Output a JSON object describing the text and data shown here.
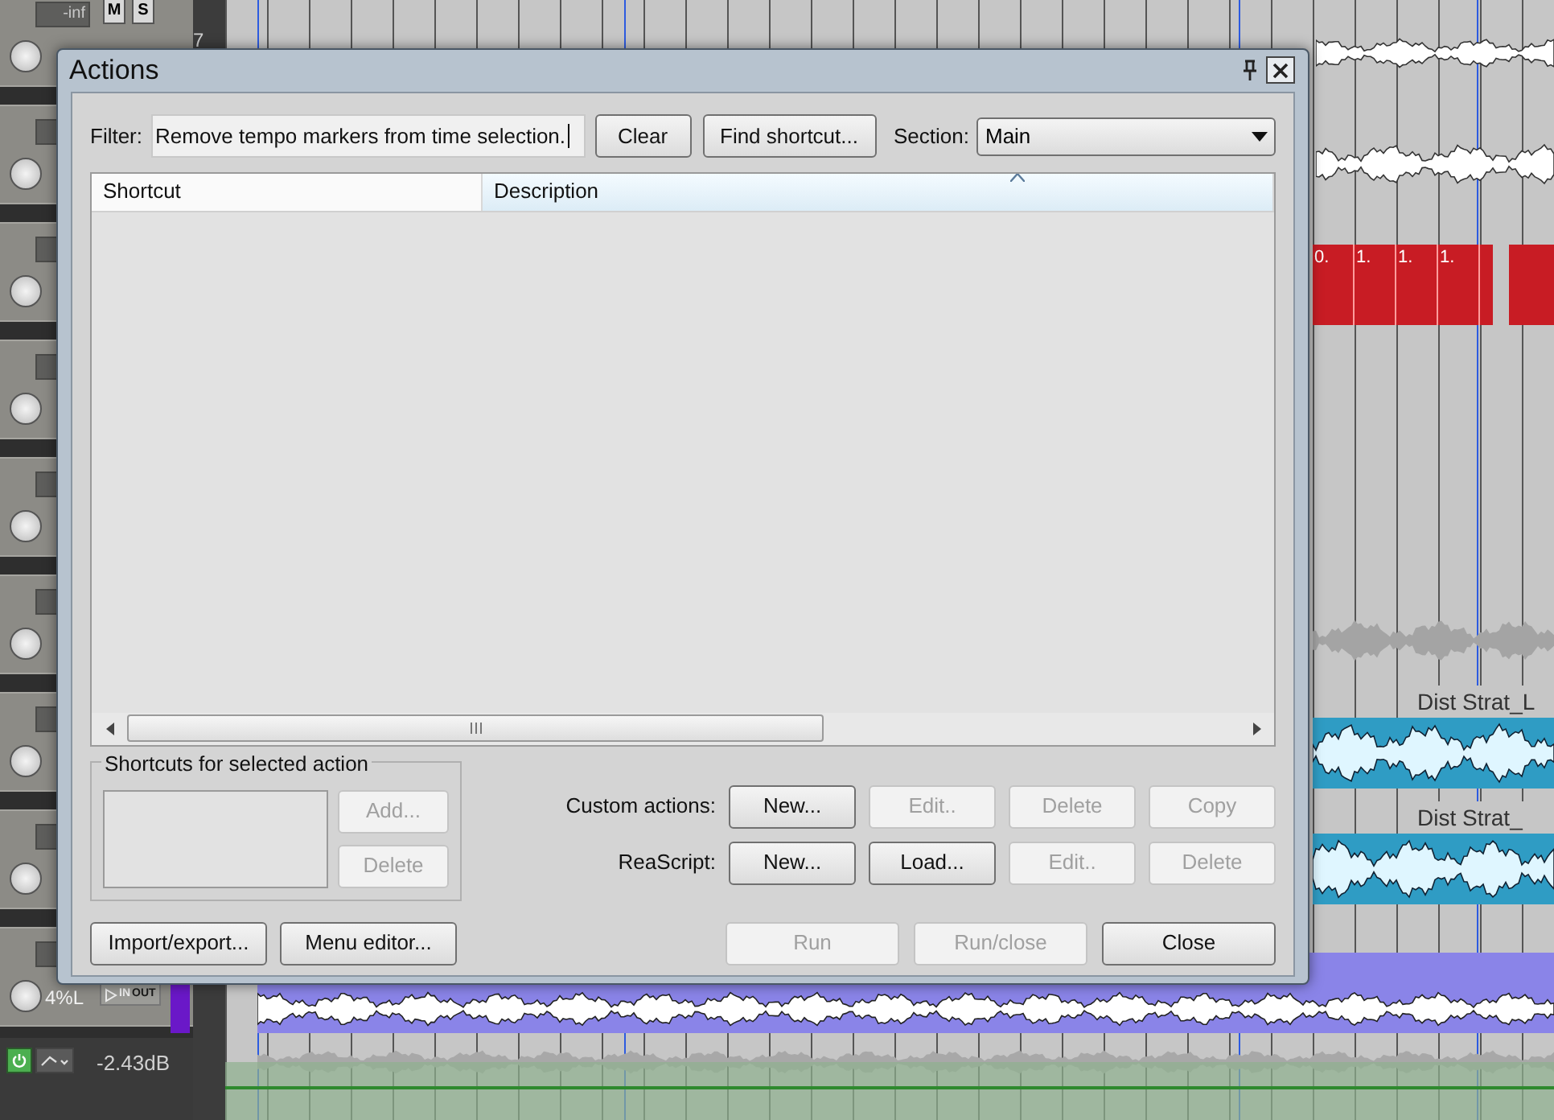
{
  "mixer": {
    "top_track": {
      "number": "7",
      "volume": "-inf",
      "mute": "M",
      "solo": "S"
    },
    "bottom_track": {
      "pan": "4%L",
      "input": "IN",
      "output": "OUT"
    },
    "master": {
      "power_on": true,
      "volume": "-2.43dB"
    }
  },
  "arrange": {
    "midi_item_labels": [
      "0.",
      "1.",
      "1.",
      "1."
    ],
    "tracks": [
      {
        "name": "Dist Strat_L"
      },
      {
        "name": "Dist Strat_"
      }
    ]
  },
  "dialog": {
    "title": "Actions",
    "filter": {
      "label": "Filter:",
      "value": "Remove tempo markers from time selection."
    },
    "clear_button": "Clear",
    "find_button": "Find shortcut...",
    "section": {
      "label": "Section:",
      "value": "Main"
    },
    "table": {
      "columns": [
        {
          "label": "Shortcut",
          "sorted": false
        },
        {
          "label": "Description",
          "sorted": true
        }
      ]
    },
    "shortcuts_group": {
      "title": "Shortcuts for selected action",
      "buttons": [
        {
          "label": "Add...",
          "disabled": true
        },
        {
          "label": "Delete",
          "disabled": true
        }
      ]
    },
    "custom_actions": {
      "label": "Custom actions:",
      "buttons": [
        {
          "label": "New...",
          "disabled": false
        },
        {
          "label": "Edit..",
          "disabled": true
        },
        {
          "label": "Delete",
          "disabled": true
        },
        {
          "label": "Copy",
          "disabled": true
        }
      ]
    },
    "reascript": {
      "label": "ReaScript:",
      "buttons": [
        {
          "label": "New...",
          "disabled": false
        },
        {
          "label": "Load...",
          "disabled": false
        },
        {
          "label": "Edit..",
          "disabled": true
        },
        {
          "label": "Delete",
          "disabled": true
        }
      ]
    },
    "footer_left": [
      {
        "label": "Import/export...",
        "disabled": false
      },
      {
        "label": "Menu editor...",
        "disabled": false
      }
    ],
    "footer_right": [
      {
        "label": "Run",
        "disabled": true
      },
      {
        "label": "Run/close",
        "disabled": true
      },
      {
        "label": "Close",
        "disabled": false
      }
    ]
  }
}
